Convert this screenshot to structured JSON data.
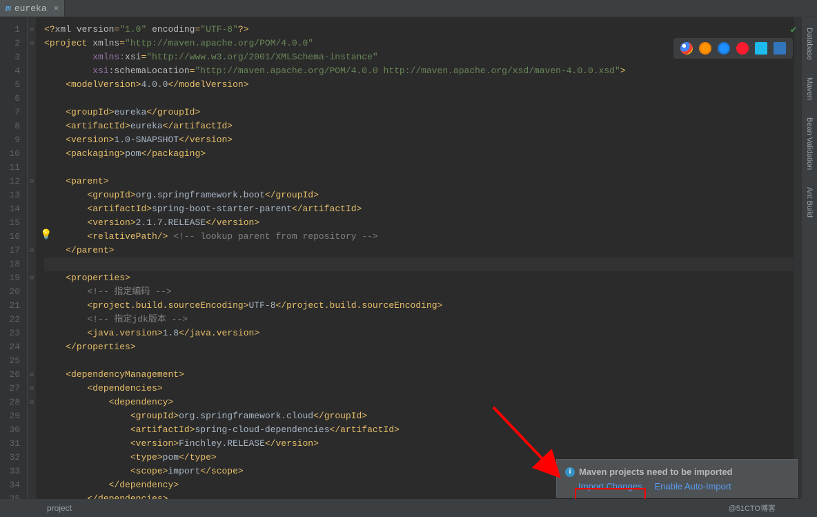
{
  "tab": {
    "name": "eureka",
    "icon": "m"
  },
  "gutter_lines": 35,
  "current_line": 18,
  "right_tools": [
    "Database",
    "Maven",
    "Bean Validation",
    "Ant Build"
  ],
  "status": {
    "left": "project",
    "right": "@51CTO博客"
  },
  "notification": {
    "title": "Maven projects need to be imported",
    "link1": "Import Changes",
    "link2": "Enable Auto-Import"
  },
  "code": [
    {
      "i": 1,
      "seg": [
        [
          "t",
          "<?"
        ],
        [
          "a",
          "xml version"
        ],
        [
          "t",
          "="
        ],
        [
          "s",
          "\"1.0\""
        ],
        [
          "a",
          " encoding"
        ],
        [
          "t",
          "="
        ],
        [
          "s",
          "\"UTF-8\""
        ],
        [
          "t",
          "?>"
        ]
      ]
    },
    {
      "i": 2,
      "seg": [
        [
          "t",
          "<"
        ],
        [
          "t",
          "project "
        ],
        [
          "a",
          "xmlns"
        ],
        [
          "t",
          "="
        ],
        [
          "s",
          "\"http://maven.apache.org/POM/4.0.0\""
        ]
      ]
    },
    {
      "i": 3,
      "seg": [
        [
          "tx",
          "         "
        ],
        [
          "ns",
          "xmlns:"
        ],
        [
          "a",
          "xsi"
        ],
        [
          "t",
          "="
        ],
        [
          "s",
          "\"http://www.w3.org/2001/XMLSchema-instance\""
        ]
      ]
    },
    {
      "i": 4,
      "seg": [
        [
          "tx",
          "         "
        ],
        [
          "ns",
          "xsi"
        ],
        [
          "a",
          ":schemaLocation"
        ],
        [
          "t",
          "="
        ],
        [
          "s",
          "\"http://maven.apache.org/POM/4.0.0 http://maven.apache.org/xsd/maven-4.0.0.xsd\""
        ],
        [
          "t",
          ">"
        ]
      ]
    },
    {
      "i": 5,
      "seg": [
        [
          "tx",
          "    "
        ],
        [
          "t",
          "<"
        ],
        [
          "t",
          "modelVersion"
        ],
        [
          "t",
          ">"
        ],
        [
          "tx",
          "4.0.0"
        ],
        [
          "t",
          "</"
        ],
        [
          "t",
          "modelVersion"
        ],
        [
          "t",
          ">"
        ]
      ]
    },
    {
      "i": 6,
      "seg": []
    },
    {
      "i": 7,
      "seg": [
        [
          "tx",
          "    "
        ],
        [
          "t",
          "<"
        ],
        [
          "t",
          "groupId"
        ],
        [
          "t",
          ">"
        ],
        [
          "tx",
          "eureka"
        ],
        [
          "t",
          "</"
        ],
        [
          "t",
          "groupId"
        ],
        [
          "t",
          ">"
        ]
      ]
    },
    {
      "i": 8,
      "seg": [
        [
          "tx",
          "    "
        ],
        [
          "t",
          "<"
        ],
        [
          "t",
          "artifactId"
        ],
        [
          "t",
          ">"
        ],
        [
          "tx",
          "eureka"
        ],
        [
          "t",
          "</"
        ],
        [
          "t",
          "artifactId"
        ],
        [
          "t",
          ">"
        ]
      ]
    },
    {
      "i": 9,
      "seg": [
        [
          "tx",
          "    "
        ],
        [
          "t",
          "<"
        ],
        [
          "t",
          "version"
        ],
        [
          "t",
          ">"
        ],
        [
          "tx",
          "1.0-SNAPSHOT"
        ],
        [
          "t",
          "</"
        ],
        [
          "t",
          "version"
        ],
        [
          "t",
          ">"
        ]
      ]
    },
    {
      "i": 10,
      "seg": [
        [
          "tx",
          "    "
        ],
        [
          "t",
          "<"
        ],
        [
          "t",
          "packaging"
        ],
        [
          "t",
          ">"
        ],
        [
          "tx",
          "pom"
        ],
        [
          "t",
          "</"
        ],
        [
          "t",
          "packaging"
        ],
        [
          "t",
          ">"
        ]
      ]
    },
    {
      "i": 11,
      "seg": []
    },
    {
      "i": 12,
      "seg": [
        [
          "tx",
          "    "
        ],
        [
          "t",
          "<"
        ],
        [
          "t",
          "parent"
        ],
        [
          "t",
          ">"
        ]
      ]
    },
    {
      "i": 13,
      "seg": [
        [
          "tx",
          "        "
        ],
        [
          "t",
          "<"
        ],
        [
          "t",
          "groupId"
        ],
        [
          "t",
          ">"
        ],
        [
          "tx",
          "org.springframework.boot"
        ],
        [
          "t",
          "</"
        ],
        [
          "t",
          "groupId"
        ],
        [
          "t",
          ">"
        ]
      ]
    },
    {
      "i": 14,
      "seg": [
        [
          "tx",
          "        "
        ],
        [
          "t",
          "<"
        ],
        [
          "t",
          "artifactId"
        ],
        [
          "t",
          ">"
        ],
        [
          "tx",
          "spring-boot-starter-parent"
        ],
        [
          "t",
          "</"
        ],
        [
          "t",
          "artifactId"
        ],
        [
          "t",
          ">"
        ]
      ]
    },
    {
      "i": 15,
      "seg": [
        [
          "tx",
          "        "
        ],
        [
          "t",
          "<"
        ],
        [
          "t",
          "version"
        ],
        [
          "t",
          ">"
        ],
        [
          "tx",
          "2.1.7.RELEASE"
        ],
        [
          "t",
          "</"
        ],
        [
          "t",
          "version"
        ],
        [
          "t",
          ">"
        ]
      ]
    },
    {
      "i": 16,
      "seg": [
        [
          "tx",
          "        "
        ],
        [
          "t",
          "<"
        ],
        [
          "t",
          "relativePath"
        ],
        [
          "t",
          "/>"
        ],
        [
          "c",
          " <!-- lookup parent from repository -->"
        ]
      ]
    },
    {
      "i": 17,
      "seg": [
        [
          "tx",
          "    "
        ],
        [
          "t",
          "</"
        ],
        [
          "t",
          "parent"
        ],
        [
          "t",
          ">"
        ]
      ]
    },
    {
      "i": 18,
      "seg": []
    },
    {
      "i": 19,
      "seg": [
        [
          "tx",
          "    "
        ],
        [
          "t",
          "<"
        ],
        [
          "t",
          "properties"
        ],
        [
          "t",
          ">"
        ]
      ]
    },
    {
      "i": 20,
      "seg": [
        [
          "tx",
          "        "
        ],
        [
          "c",
          "<!-- 指定编码 -->"
        ]
      ]
    },
    {
      "i": 21,
      "seg": [
        [
          "tx",
          "        "
        ],
        [
          "t",
          "<"
        ],
        [
          "t",
          "project.build.sourceEncoding"
        ],
        [
          "t",
          ">"
        ],
        [
          "tx",
          "UTF-8"
        ],
        [
          "t",
          "</"
        ],
        [
          "t",
          "project.build.sourceEncoding"
        ],
        [
          "t",
          ">"
        ]
      ]
    },
    {
      "i": 22,
      "seg": [
        [
          "tx",
          "        "
        ],
        [
          "c",
          "<!-- 指定jdk版本 -->"
        ]
      ]
    },
    {
      "i": 23,
      "seg": [
        [
          "tx",
          "        "
        ],
        [
          "t",
          "<"
        ],
        [
          "t",
          "java.version"
        ],
        [
          "t",
          ">"
        ],
        [
          "tx",
          "1.8"
        ],
        [
          "t",
          "</"
        ],
        [
          "t",
          "java.version"
        ],
        [
          "t",
          ">"
        ]
      ]
    },
    {
      "i": 24,
      "seg": [
        [
          "tx",
          "    "
        ],
        [
          "t",
          "</"
        ],
        [
          "t",
          "properties"
        ],
        [
          "t",
          ">"
        ]
      ]
    },
    {
      "i": 25,
      "seg": []
    },
    {
      "i": 26,
      "seg": [
        [
          "tx",
          "    "
        ],
        [
          "t",
          "<"
        ],
        [
          "t",
          "dependencyManagement"
        ],
        [
          "t",
          ">"
        ]
      ]
    },
    {
      "i": 27,
      "seg": [
        [
          "tx",
          "        "
        ],
        [
          "t",
          "<"
        ],
        [
          "t",
          "dependencies"
        ],
        [
          "t",
          ">"
        ]
      ]
    },
    {
      "i": 28,
      "seg": [
        [
          "tx",
          "            "
        ],
        [
          "t",
          "<"
        ],
        [
          "t",
          "dependency"
        ],
        [
          "t",
          ">"
        ]
      ]
    },
    {
      "i": 29,
      "seg": [
        [
          "tx",
          "                "
        ],
        [
          "t",
          "<"
        ],
        [
          "t",
          "groupId"
        ],
        [
          "t",
          ">"
        ],
        [
          "tx",
          "org.springframework.cloud"
        ],
        [
          "t",
          "</"
        ],
        [
          "t",
          "groupId"
        ],
        [
          "t",
          ">"
        ]
      ]
    },
    {
      "i": 30,
      "seg": [
        [
          "tx",
          "                "
        ],
        [
          "t",
          "<"
        ],
        [
          "t",
          "artifactId"
        ],
        [
          "t",
          ">"
        ],
        [
          "tx",
          "spring-cloud-dependencies"
        ],
        [
          "t",
          "</"
        ],
        [
          "t",
          "artifactId"
        ],
        [
          "t",
          ">"
        ]
      ]
    },
    {
      "i": 31,
      "seg": [
        [
          "tx",
          "                "
        ],
        [
          "t",
          "<"
        ],
        [
          "t",
          "version"
        ],
        [
          "t",
          ">"
        ],
        [
          "tx",
          "Finchley.RELEASE"
        ],
        [
          "t",
          "</"
        ],
        [
          "t",
          "version"
        ],
        [
          "t",
          ">"
        ]
      ]
    },
    {
      "i": 32,
      "seg": [
        [
          "tx",
          "                "
        ],
        [
          "t",
          "<"
        ],
        [
          "t",
          "type"
        ],
        [
          "t",
          ">"
        ],
        [
          "tx",
          "pom"
        ],
        [
          "t",
          "</"
        ],
        [
          "t",
          "type"
        ],
        [
          "t",
          ">"
        ]
      ]
    },
    {
      "i": 33,
      "seg": [
        [
          "tx",
          "                "
        ],
        [
          "t",
          "<"
        ],
        [
          "t",
          "scope"
        ],
        [
          "t",
          ">"
        ],
        [
          "tx",
          "import"
        ],
        [
          "t",
          "</"
        ],
        [
          "t",
          "scope"
        ],
        [
          "t",
          ">"
        ]
      ]
    },
    {
      "i": 34,
      "seg": [
        [
          "tx",
          "            "
        ],
        [
          "t",
          "</"
        ],
        [
          "t",
          "dependency"
        ],
        [
          "t",
          ">"
        ]
      ]
    },
    {
      "i": 35,
      "seg": [
        [
          "tx",
          "        "
        ],
        [
          "t",
          "</"
        ],
        [
          "t",
          "dependencies"
        ],
        [
          "t",
          ">"
        ]
      ]
    }
  ],
  "fold_lines": [
    1,
    2,
    12,
    17,
    19,
    26,
    27,
    28
  ],
  "browsers": [
    "chrome",
    "firefox",
    "safari",
    "opera",
    "ie",
    "edge"
  ]
}
